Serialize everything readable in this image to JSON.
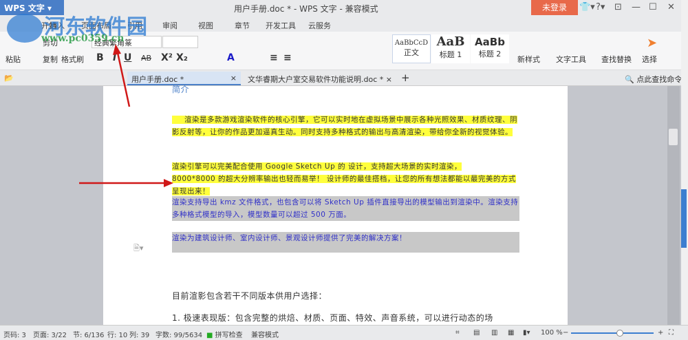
{
  "app": {
    "name": "WPS 文字",
    "title": "用户手册.doc * - WPS 文字 - 兼容模式",
    "login": "未登录"
  },
  "window": {
    "skin": "👕▾",
    "help": "?▾",
    "minimize": "—",
    "maximize": "☐",
    "close": "✕"
  },
  "menu": [
    "开始",
    "插入",
    "页面布局",
    "引用",
    "审阅",
    "视图",
    "章节",
    "开发工具",
    "云服务"
  ],
  "ribbon": {
    "paste": "粘贴",
    "cut": "剪切",
    "copy": "复制",
    "format_painter": "格式刷",
    "font_name": "经典繁角篆",
    "font_size": "",
    "bold": "B",
    "italic": "I",
    "underline": "U",
    "strike": "AB",
    "superscript": "X²",
    "subscript": "X₂",
    "styles": [
      {
        "preview": "AaBbCcD",
        "label": "正文"
      },
      {
        "preview": "AaB",
        "label": "标题 1"
      },
      {
        "preview": "AaBb",
        "label": "标题 2"
      }
    ],
    "new_style": "新样式",
    "text_tools": "文字工具",
    "find_replace": "查找替换",
    "select": "选择"
  },
  "tabs": [
    {
      "label": "用户手册.doc *",
      "active": true
    },
    {
      "label": "文华睿期大户室交易软件功能说明.doc *",
      "active": false
    }
  ],
  "search_command": "点此查找命令",
  "document": {
    "heading": "简介",
    "p1": "渲染是多款游戏渲染软件的核心引擎，它可以实时地在虚拟场景中展示各种光照效果、材质纹理、阴影反射等，让你的作品更加逼真生动。同时支持多种格式的输出与高清渲染，带给你全新的视觉体验。",
    "p2a": "渲染引擎可以完美配合使用 Google Sketch Up 的 设计，支持超大场景的实时渲染，",
    "p2b": "8000*8000 的超大分辨率输出也轻而易举！ 设计师的最佳搭档，让您的所有想法都能以最完美的方式呈现出来！",
    "p3": "渲染支持导出 kmz 文件格式，也包含可以将 Sketch Up 插件直接导出的模型输出到渲染中。渲染支持多种格式模型的导入，模型数量可以超过 500 万面。",
    "p4": "渲染为建筑设计师、室内设计师、景观设计师提供了完美的解决方案！",
    "p5": "目前渲影包含若干不同版本供用户选择：",
    "p6": "1.   极速表现版：包含完整的烘焙、材质、页面、特效、声音系统，可以进行动态的场"
  },
  "status": {
    "page": "页码: 3",
    "pages": "页面: 3/22",
    "section": "节: 6/136",
    "row": "行: 10",
    "col": "列: 39",
    "words": "字数: 99/5634",
    "spell": "拼写检查",
    "mode": "兼容模式",
    "zoom": "100 %",
    "zoom_fraction": 0.6
  },
  "watermark": {
    "name": "河东软件园",
    "url": "www.pc0359.cn"
  }
}
